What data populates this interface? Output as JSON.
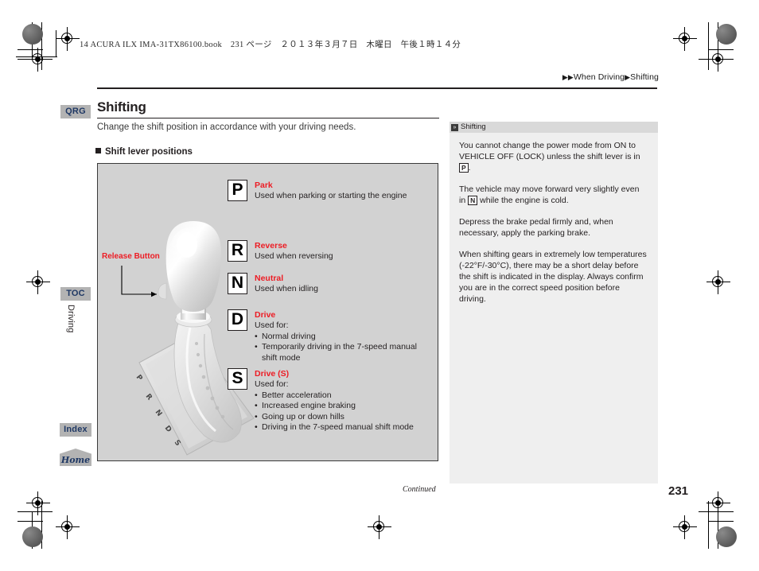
{
  "print_header": {
    "book_line": "14 ACURA ILX IMA-31TX86100.book　231 ページ　２０１３年３月７日　木曜日　午後１時１４分"
  },
  "breadcrumb": {
    "marker": "▶▶",
    "separator": "▶",
    "items": [
      "When Driving",
      "Shifting"
    ]
  },
  "sidenav": {
    "qrg_label": "QRG",
    "toc_label": "TOC",
    "index_label": "Index",
    "home_label": "Home",
    "section_label": "Driving"
  },
  "page": {
    "title": "Shifting",
    "intro": "Change the shift position in accordance with your driving needs.",
    "section_heading": "Shift lever positions",
    "continued_label": "Continued",
    "page_number": "231"
  },
  "diagram": {
    "release_button_label": "Release Button",
    "lever_plate_letters": [
      "P",
      "R",
      "N",
      "D",
      "S"
    ]
  },
  "gears": [
    {
      "letter": "P",
      "name": "Park",
      "desc": "Used when parking or starting the engine",
      "bullets": []
    },
    {
      "letter": "R",
      "name": "Reverse",
      "desc": "Used when reversing",
      "bullets": []
    },
    {
      "letter": "N",
      "name": "Neutral",
      "desc": "Used when idling",
      "bullets": []
    },
    {
      "letter": "D",
      "name": "Drive",
      "desc": "Used for:",
      "bullets": [
        "Normal driving",
        "Temporarily driving in the 7-speed manual",
        "shift mode"
      ]
    },
    {
      "letter": "S",
      "name": "Drive (S)",
      "desc": "Used for:",
      "bullets": [
        "Better acceleration",
        "Increased engine braking",
        "Going up or down hills",
        "Driving in the 7-speed manual shift mode"
      ]
    }
  ],
  "note": {
    "header_title": "Shifting",
    "header_icon": "chevron-double-right-icon",
    "paragraphs": [
      {
        "before": "You cannot change the power mode from ON to VEHICLE OFF (LOCK) unless the shift lever is in ",
        "box": "P",
        "after": "."
      },
      {
        "before": "The vehicle may move forward very slightly even in ",
        "box": "N",
        "after": " while the engine is cold."
      },
      {
        "before": "Depress the brake pedal firmly and, when necessary, apply the parking brake.",
        "box": "",
        "after": ""
      },
      {
        "before": "When shifting gears in extremely low temperatures (-22°F/-30°C), there may be a short delay before the shift is indicated in the display. Always confirm you are in the correct speed position before driving.",
        "box": "",
        "after": ""
      }
    ]
  },
  "colors": {
    "accent_red": "#ed1c24",
    "tab_gray": "#b3b3b3",
    "tab_text": "#1f3864",
    "panel_gray": "#d2d2d2",
    "note_gray": "#efefef"
  }
}
